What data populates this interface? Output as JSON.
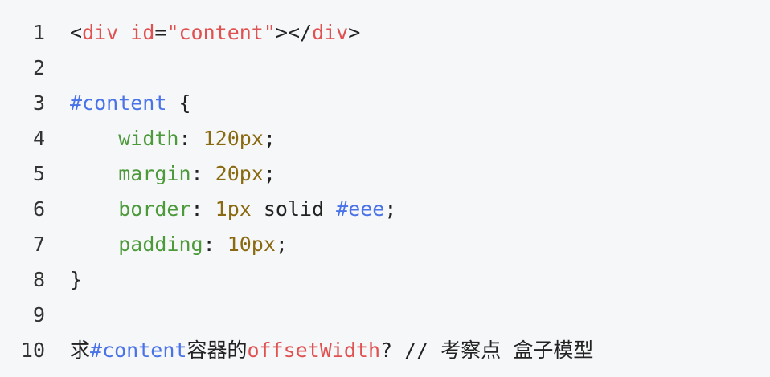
{
  "editor": {
    "lines": [
      {
        "num": "1",
        "tokens": [
          {
            "t": "<",
            "k": "punc"
          },
          {
            "t": "div",
            "k": "tag"
          },
          {
            "t": " ",
            "k": "plain"
          },
          {
            "t": "id",
            "k": "attr"
          },
          {
            "t": "=",
            "k": "punc"
          },
          {
            "t": "\"content\"",
            "k": "str"
          },
          {
            "t": "></",
            "k": "punc"
          },
          {
            "t": "div",
            "k": "tag"
          },
          {
            "t": ">",
            "k": "punc"
          }
        ]
      },
      {
        "num": "2",
        "tokens": []
      },
      {
        "num": "3",
        "tokens": [
          {
            "t": "#content",
            "k": "sel"
          },
          {
            "t": " {",
            "k": "punc"
          }
        ]
      },
      {
        "num": "4",
        "tokens": [
          {
            "t": "    ",
            "k": "plain"
          },
          {
            "t": "width",
            "k": "prop"
          },
          {
            "t": ": ",
            "k": "punc"
          },
          {
            "t": "120px",
            "k": "num"
          },
          {
            "t": ";",
            "k": "punc"
          }
        ]
      },
      {
        "num": "5",
        "tokens": [
          {
            "t": "    ",
            "k": "plain"
          },
          {
            "t": "margin",
            "k": "prop"
          },
          {
            "t": ": ",
            "k": "punc"
          },
          {
            "t": "20px",
            "k": "num"
          },
          {
            "t": ";",
            "k": "punc"
          }
        ]
      },
      {
        "num": "6",
        "tokens": [
          {
            "t": "    ",
            "k": "plain"
          },
          {
            "t": "border",
            "k": "prop"
          },
          {
            "t": ": ",
            "k": "punc"
          },
          {
            "t": "1px",
            "k": "num"
          },
          {
            "t": " solid ",
            "k": "plain"
          },
          {
            "t": "#eee",
            "k": "hex"
          },
          {
            "t": ";",
            "k": "punc"
          }
        ]
      },
      {
        "num": "7",
        "tokens": [
          {
            "t": "    ",
            "k": "plain"
          },
          {
            "t": "padding",
            "k": "prop"
          },
          {
            "t": ": ",
            "k": "punc"
          },
          {
            "t": "10px",
            "k": "num"
          },
          {
            "t": ";",
            "k": "punc"
          }
        ]
      },
      {
        "num": "8",
        "tokens": [
          {
            "t": "}",
            "k": "punc"
          }
        ]
      },
      {
        "num": "9",
        "tokens": []
      },
      {
        "num": "10",
        "tokens": [
          {
            "t": "求",
            "k": "plain"
          },
          {
            "t": "#content",
            "k": "sel"
          },
          {
            "t": "容器的",
            "k": "plain"
          },
          {
            "t": "offsetWidth",
            "k": "tag"
          },
          {
            "t": "? // 考察点 盒子模型",
            "k": "plain"
          }
        ]
      }
    ]
  },
  "colors": {
    "background": "#f6f7f9",
    "tag": "#e05252",
    "selector": "#4a73e8",
    "property": "#4c9a3a",
    "number": "#8a6a10"
  }
}
